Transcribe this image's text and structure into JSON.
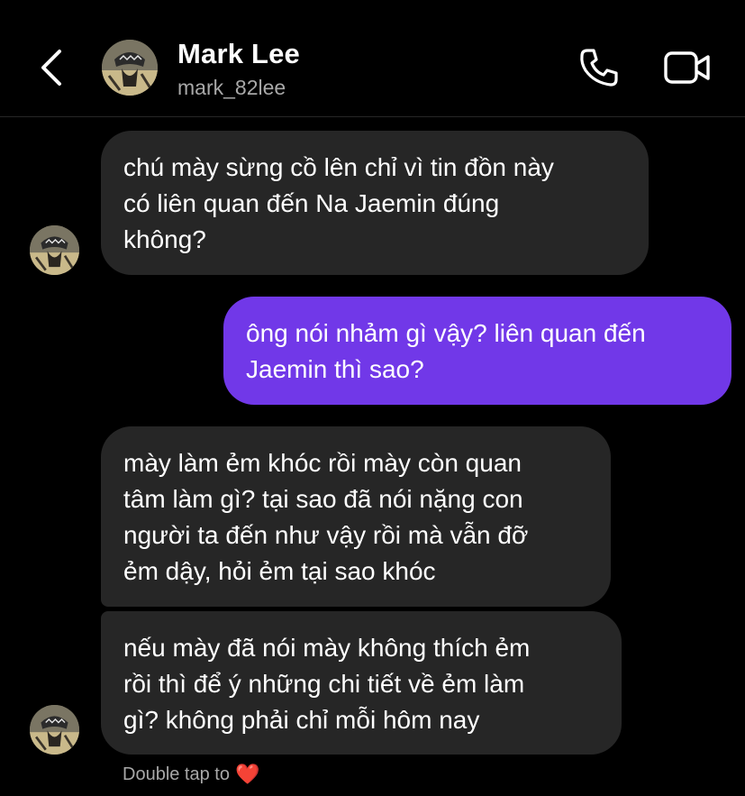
{
  "header": {
    "name": "Mark Lee",
    "username": "mark_82lee",
    "back_icon": "chevron-left-icon",
    "call_icon": "phone-icon",
    "video_icon": "video-camera-icon"
  },
  "messages": [
    {
      "direction": "incoming",
      "lines": [
        "chú mày sừng cồ lên chỉ vì tin đồn này",
        "có liên quan đến Na Jaemin đúng",
        "không?"
      ]
    },
    {
      "direction": "outgoing",
      "lines": [
        "ông nói nhảm gì vậy? liên quan đến",
        "Jaemin thì sao?"
      ]
    },
    {
      "direction": "incoming",
      "lines": [
        "mày làm ẻm khóc rồi mày còn quan",
        "tâm làm gì? tại sao đã nói nặng con",
        "người ta đến như vậy rồi mà vẫn đỡ",
        "ẻm dậy, hỏi ẻm tại sao khóc"
      ]
    },
    {
      "direction": "incoming",
      "lines": [
        "nếu mày đã nói mày không thích ẻm",
        "rồi thì để ý những chi tiết về ẻm làm",
        "gì? không phải chỉ mỗi hôm nay"
      ]
    }
  ],
  "hint": {
    "text": "Double tap to",
    "emoji": "❤️"
  },
  "colors": {
    "background": "#000000",
    "incoming_bubble": "#262626",
    "outgoing_bubble": "#7138e8",
    "secondary_text": "#a8a8a8"
  }
}
